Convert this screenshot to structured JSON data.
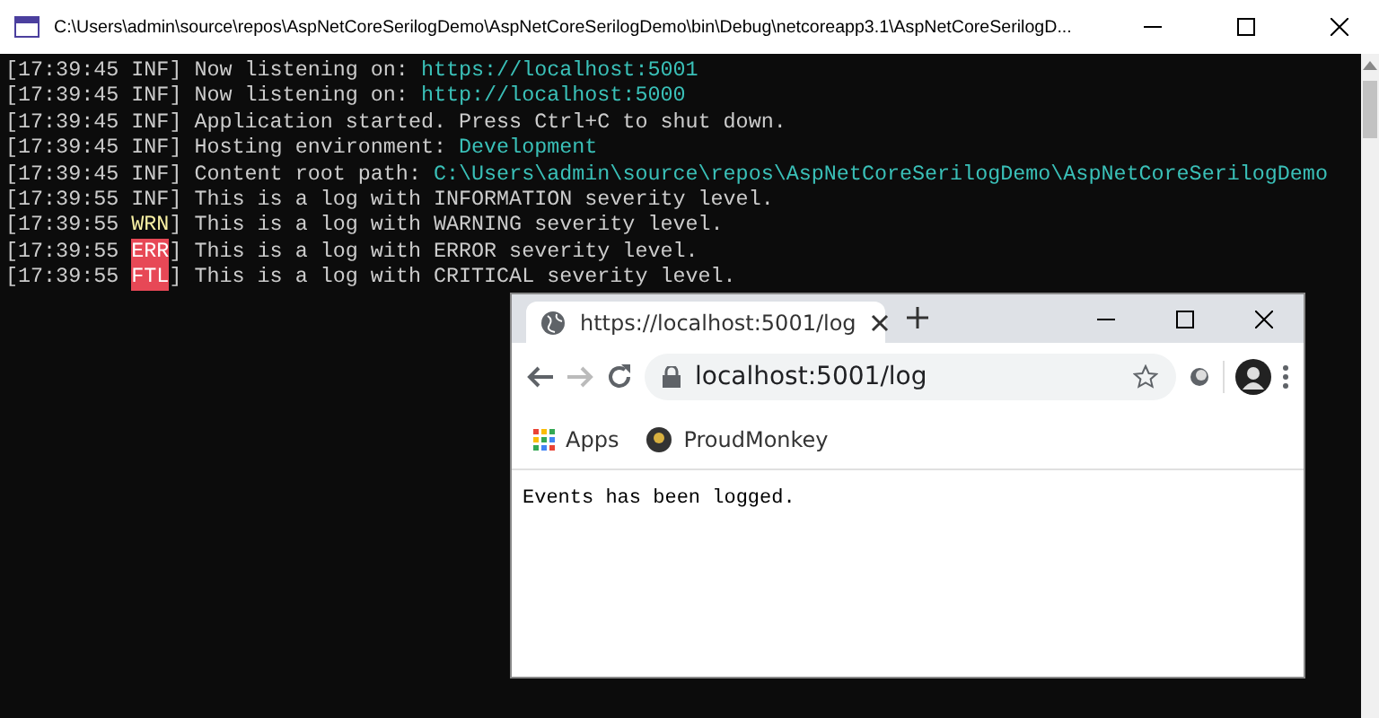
{
  "console": {
    "title": "C:\\Users\\admin\\source\\repos\\AspNetCoreSerilogDemo\\AspNetCoreSerilogDemo\\bin\\Debug\\netcoreapp3.1\\AspNetCoreSerilogD...",
    "lines": [
      {
        "time": "[17:39:45",
        "level": "INF",
        "kind": "info",
        "text": "] Now listening on: ",
        "value": "https://localhost:5001"
      },
      {
        "time": "[17:39:45",
        "level": "INF",
        "kind": "info",
        "text": "] Now listening on: ",
        "value": "http://localhost:5000"
      },
      {
        "time": "[17:39:45",
        "level": "INF",
        "kind": "info",
        "text": "] Application started. Press Ctrl+C to shut down."
      },
      {
        "time": "[17:39:45",
        "level": "INF",
        "kind": "info",
        "text": "] Hosting environment: ",
        "value": "Development"
      },
      {
        "time": "[17:39:45",
        "level": "INF",
        "kind": "info",
        "text": "] Content root path: ",
        "value": "C:\\Users\\admin\\source\\repos\\AspNetCoreSerilogDemo\\AspNetCoreSerilogDemo"
      },
      {
        "time": "[17:39:55",
        "level": "INF",
        "kind": "info",
        "text": "] This is a log with INFORMATION severity level."
      },
      {
        "time": "[17:39:55",
        "level": "WRN",
        "kind": "warn",
        "text": "] This is a log with WARNING severity level."
      },
      {
        "time": "[17:39:55",
        "level": "ERR",
        "kind": "error",
        "text": "] This is a log with ERROR severity level."
      },
      {
        "time": "[17:39:55",
        "level": "FTL",
        "kind": "fatal",
        "text": "] This is a log with CRITICAL severity level."
      }
    ]
  },
  "browser": {
    "tab": {
      "title": "https://localhost:5001/log",
      "selected": true
    },
    "address": "localhost:5001/log",
    "bookmarks": [
      "Apps",
      "ProudMonkey"
    ],
    "content": "Events has been logged."
  }
}
